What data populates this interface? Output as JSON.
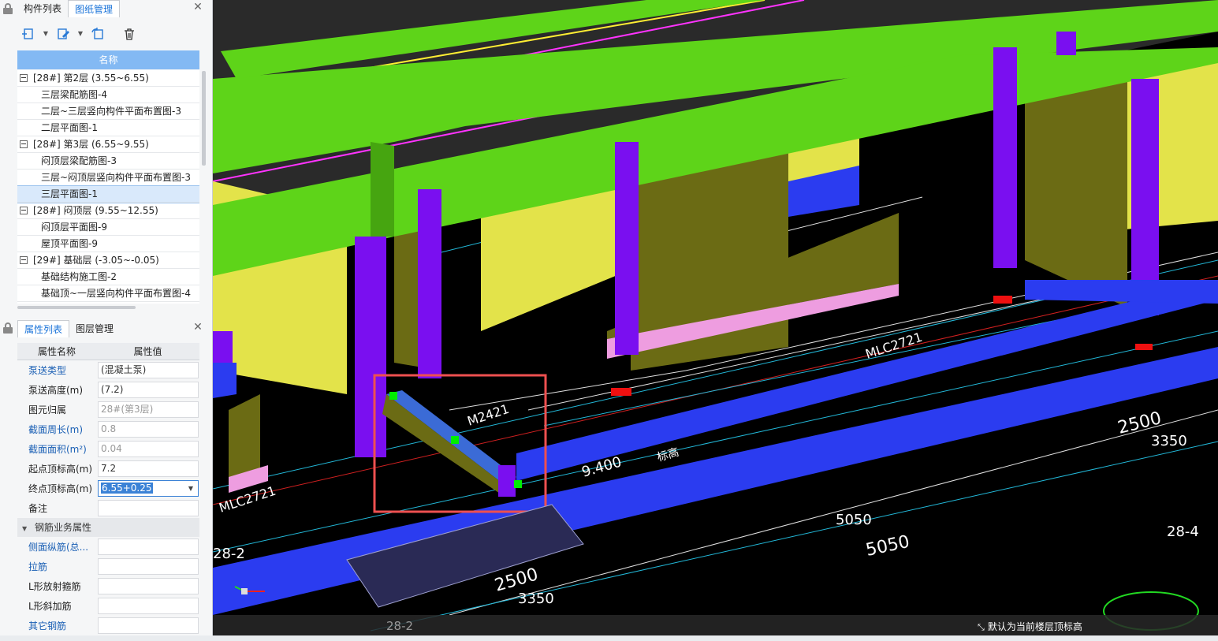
{
  "top_panel": {
    "tabs": [
      "构件列表",
      "图纸管理"
    ],
    "active_tab": 1,
    "close": "✕"
  },
  "toolbar": {
    "buttons": [
      "add-drawing-icon",
      "edit-drawing-icon",
      "replace-drawing-icon",
      "delete-icon"
    ]
  },
  "tree": {
    "header": "名称",
    "rows": [
      {
        "type": "group",
        "label": "[28#] 第2层 (3.55~6.55)"
      },
      {
        "type": "leaf",
        "label": "三层梁配筋图-4"
      },
      {
        "type": "leaf",
        "label": "二层~三层竖向构件平面布置图-3"
      },
      {
        "type": "leaf",
        "label": "二层平面图-1"
      },
      {
        "type": "group",
        "label": "[28#] 第3层 (6.55~9.55)"
      },
      {
        "type": "leaf",
        "label": "闷顶层梁配筋图-3"
      },
      {
        "type": "leaf",
        "label": "三层~闷顶层竖向构件平面布置图-3"
      },
      {
        "type": "leaf",
        "label": "三层平面图-1",
        "selected": true
      },
      {
        "type": "group",
        "label": "[28#] 闷顶层 (9.55~12.55)"
      },
      {
        "type": "leaf",
        "label": "闷顶层平面图-9"
      },
      {
        "type": "leaf",
        "label": "屋顶平面图-9"
      },
      {
        "type": "group",
        "label": "[29#] 基础层 (-3.05~-0.05)"
      },
      {
        "type": "leaf",
        "label": "基础结构施工图-2"
      },
      {
        "type": "leaf",
        "label": "基础顶~一层竖向构件平面布置图-4"
      }
    ]
  },
  "bottom_panel": {
    "tabs": [
      "属性列表",
      "图层管理"
    ],
    "active_tab": 0,
    "close": "✕"
  },
  "properties": {
    "col_name": "属性名称",
    "col_value": "属性值",
    "rows": [
      {
        "name": "泵送类型",
        "value": "(混凝土泵)",
        "blue": true,
        "gray": false
      },
      {
        "name": "泵送高度(m)",
        "value": "(7.2)",
        "blue": false,
        "gray": false
      },
      {
        "name": "图元归属",
        "value": "28#(第3层)",
        "blue": false,
        "gray": true
      },
      {
        "name": "截面周长(m)",
        "value": "0.8",
        "blue": true,
        "gray": true
      },
      {
        "name": "截面面积(m²)",
        "value": "0.04",
        "blue": true,
        "gray": true
      },
      {
        "name": "起点顶标高(m)",
        "value": "7.2",
        "blue": false,
        "gray": false
      },
      {
        "name": "终点顶标高(m)",
        "value": "6.55+0.25",
        "blue": false,
        "gray": false,
        "active": true
      },
      {
        "name": "备注",
        "value": "",
        "blue": false,
        "gray": false
      }
    ],
    "section": "钢筋业务属性",
    "rebar_rows": [
      {
        "name": "侧面纵筋(总...",
        "value": "",
        "blue": true
      },
      {
        "name": "拉筋",
        "value": "",
        "blue": true
      },
      {
        "name": "L形放射箍筋",
        "value": "",
        "blue": false
      },
      {
        "name": "L形斜加筋",
        "value": "",
        "blue": false
      },
      {
        "name": "其它钢筋",
        "value": "",
        "blue": true
      }
    ]
  },
  "viewport": {
    "status_text": "默认为当前楼层顶标高",
    "bottom_label": "28-2",
    "dim_labels": [
      "5050",
      "5050",
      "3350",
      "2500",
      "3350",
      "2500",
      "28-4",
      "28-2",
      "9.400",
      "MLC2721",
      "MLC2721",
      "M2421",
      "标高"
    ],
    "colors": {
      "slab": "#5ed419",
      "column": "#7a0ff0",
      "wall": "#6b6b14",
      "wall_face": "#e3e34a",
      "beam": "#2b3cf0",
      "pink": "#ee9de0",
      "highlight": "#ee5050"
    }
  }
}
